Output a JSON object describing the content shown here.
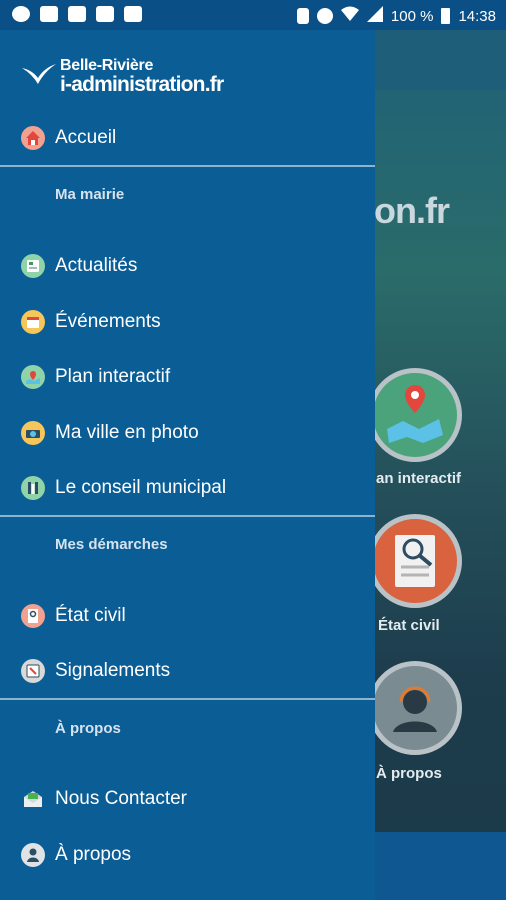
{
  "status_bar": {
    "battery_text": "100 %",
    "time": "14:38"
  },
  "drawer": {
    "logo": {
      "line1": "Belle-Rivière",
      "line2": "i-administration.fr"
    },
    "home": {
      "label": "Accueil"
    },
    "sections": [
      {
        "title": "Ma mairie"
      },
      {
        "title": "Mes démarches"
      },
      {
        "title": "À propos"
      }
    ],
    "items": [
      {
        "label": "Actualités",
        "icon": "news-icon"
      },
      {
        "label": "Événements",
        "icon": "calendar-icon"
      },
      {
        "label": "Plan interactif",
        "icon": "map-icon"
      },
      {
        "label": "Ma ville en photo",
        "icon": "camera-icon"
      },
      {
        "label": "Le conseil municipal",
        "icon": "council-icon"
      },
      {
        "label": "État civil",
        "icon": "document-icon"
      },
      {
        "label": "Signalements",
        "icon": "report-icon"
      },
      {
        "label": "Nous Contacter",
        "icon": "mail-icon"
      },
      {
        "label": "À propos",
        "icon": "person-icon"
      }
    ]
  },
  "background": {
    "brand_fragment": "on.fr",
    "tiles": [
      {
        "label": "an interactif"
      },
      {
        "label": "État civil"
      },
      {
        "label": "À propos"
      }
    ]
  }
}
